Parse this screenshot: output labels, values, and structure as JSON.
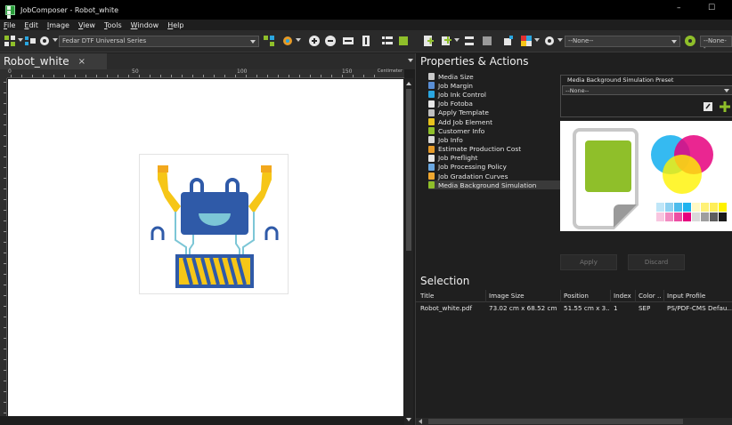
{
  "window": {
    "title": "JobComposer - Robot_white",
    "minimize_symbol": "–",
    "maximize_symbol": "☐"
  },
  "menu": [
    "File",
    "Edit",
    "Image",
    "View",
    "Tools",
    "Window",
    "Help"
  ],
  "toolbar": {
    "printer_combo": "Fedar DTF Universal Series",
    "none_combo_1": "--None--",
    "none_combo_2": "--None--"
  },
  "document": {
    "tab_label": "Robot_white",
    "tab_close": "×",
    "ruler": {
      "labels": [
        "0",
        "50",
        "100",
        "150"
      ],
      "unit": "Centimeter"
    }
  },
  "properties": {
    "title": "Properties & Actions",
    "actions": [
      {
        "label": "Media Size",
        "icon": "media-size-icon",
        "color": "#c9c9c9"
      },
      {
        "label": "Job Margin",
        "icon": "margin-icon",
        "color": "#5a8fd6"
      },
      {
        "label": "Job Ink Control",
        "icon": "ink-drop-icon",
        "color": "#2aa6e0"
      },
      {
        "label": "Job Fotoba",
        "icon": "fotoba-icon",
        "color": "#e6e6e6"
      },
      {
        "label": "Apply Template",
        "icon": "template-icon",
        "color": "#bfbfbf"
      },
      {
        "label": "Add Job Element",
        "icon": "add-element-icon",
        "color": "#e7c21d"
      },
      {
        "label": "Customer Info",
        "icon": "customer-icon",
        "color": "#8fbf2a"
      },
      {
        "label": "Job Info",
        "icon": "info-icon",
        "color": "#d9d9d9"
      },
      {
        "label": "Estimate Production Cost",
        "icon": "cost-icon",
        "color": "#e59a28"
      },
      {
        "label": "Job Preflight",
        "icon": "preflight-icon",
        "color": "#e6e6e6"
      },
      {
        "label": "Job Processing Policy",
        "icon": "policy-icon",
        "color": "#6aa7e0"
      },
      {
        "label": "Job Gradation Curves",
        "icon": "curves-icon",
        "color": "#f0a830"
      },
      {
        "label": "Media Background Simulation",
        "icon": "media-bg-icon",
        "color": "#8fbf2a"
      }
    ],
    "selected_action": "Media Background Simulation",
    "preset_label": "Media Background Simulation Preset",
    "preset_value": "--None--",
    "apply_label": "Apply",
    "discard_label": "Discard"
  },
  "selection": {
    "title": "Selection",
    "columns": [
      "Title",
      "Image Size",
      "Position",
      "Index",
      "Color ...",
      "Input Profile"
    ],
    "rows": [
      [
        "Robot_white.pdf",
        "73.02 cm x 68.52 cm",
        "51.55 cm x 3...",
        "1",
        "SEP",
        "PS/PDF-CMS Defau..."
      ]
    ]
  },
  "colors": {
    "accent_green": "#8fbf2a",
    "robot_yellow": "#f6c617",
    "robot_blue": "#2f5aa8",
    "robot_teal": "#7cc6d6"
  }
}
